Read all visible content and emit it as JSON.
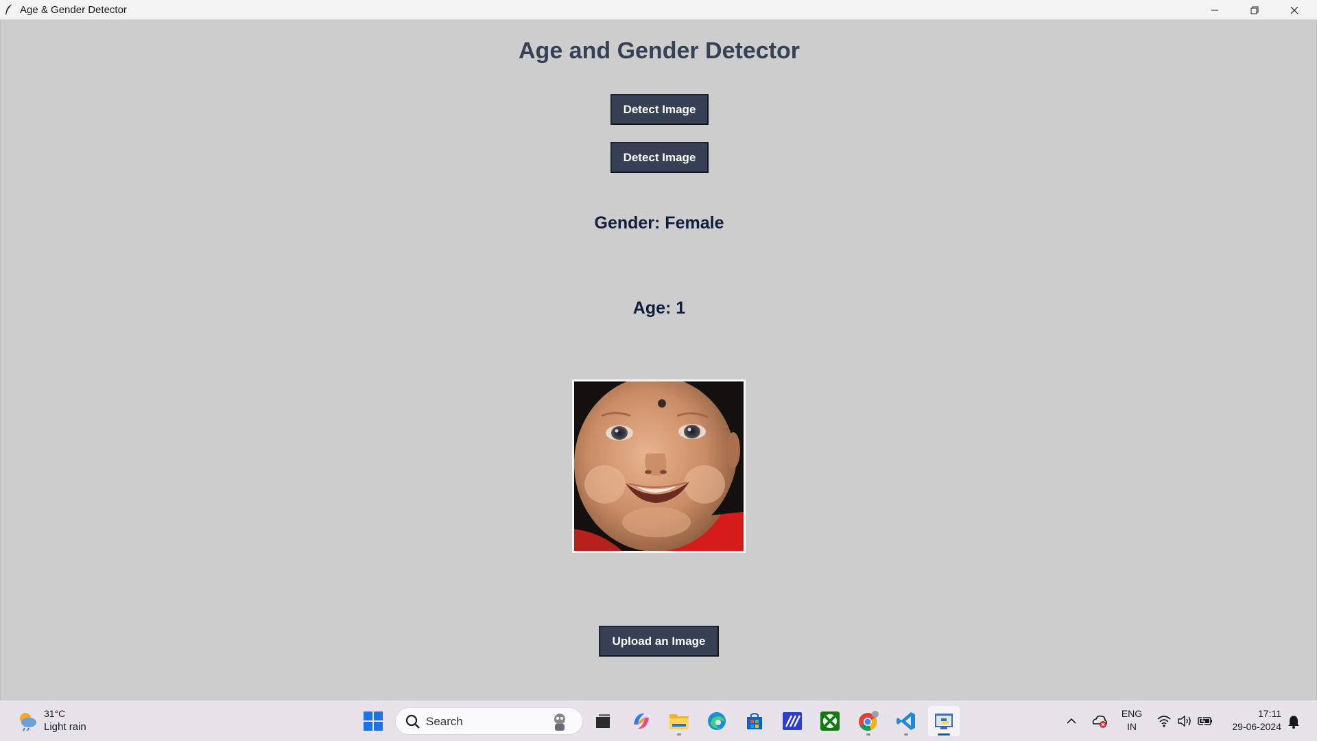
{
  "window": {
    "title": "Age & Gender Detector"
  },
  "app": {
    "heading": "Age and Gender Detector",
    "detect_button_1": "Detect Image",
    "detect_button_2": "Detect Image",
    "gender_text": "Gender: Female",
    "age_text": "Age: 1",
    "upload_button": "Upload an Image",
    "photo_label": "uploaded face photo (smiling baby)"
  },
  "taskbar": {
    "weather_temp": "31°C",
    "weather_desc": "Light rain",
    "search_placeholder": "Search",
    "apps": [
      "start-icon",
      "task-view-icon",
      "copilot-icon",
      "file-explorer-icon",
      "edge-icon",
      "store-icon",
      "app-icon",
      "xbox-icon",
      "chrome-icon",
      "vscode-icon",
      "python-app-icon"
    ],
    "tray": {
      "lang_top": "ENG",
      "lang_bottom": "IN",
      "time": "17:11",
      "date": "29-06-2024"
    }
  },
  "colors": {
    "background": "#cdcdcd",
    "button": "#364156",
    "heading": "#364156",
    "result_text": "#101d3b"
  }
}
